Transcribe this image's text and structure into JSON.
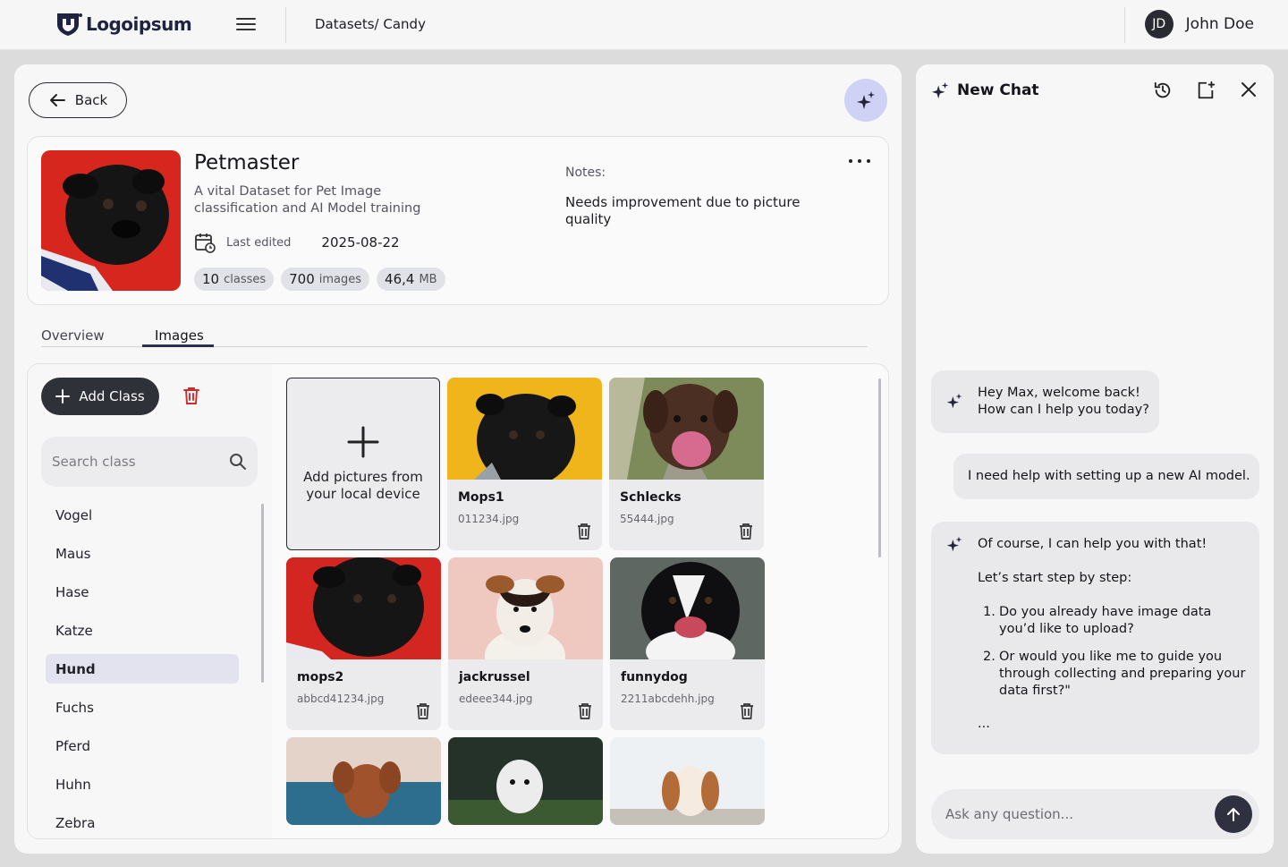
{
  "topbar": {
    "logo_text": "Logoipsum",
    "breadcrumb": "Datasets/ Candy",
    "user_initials": "JD",
    "user_name": "John Doe"
  },
  "main": {
    "back_label": "Back",
    "dataset": {
      "title": "Petmaster",
      "description": "A vital Dataset for Pet Image classification and AI Model training",
      "last_edited_label": "Last edited",
      "last_edited_value": "2025-08-22",
      "chips": [
        {
          "num": "10",
          "unit": "classes"
        },
        {
          "num": "700",
          "unit": "images"
        },
        {
          "num": "46,4",
          "unit": "MB"
        }
      ],
      "notes_label": "Notes:",
      "notes_text": "Needs improvement due to picture quality"
    },
    "tabs": [
      {
        "label": "Overview",
        "active": false
      },
      {
        "label": "Images",
        "active": true
      }
    ],
    "add_class_label": "Add Class",
    "search": {
      "placeholder": "Search class"
    },
    "classes": [
      "Vogel",
      "Maus",
      "Hase",
      "Katze",
      "Hund",
      "Fuchs",
      "Pferd",
      "Huhn",
      "Zebra"
    ],
    "active_class": "Hund",
    "add_tile_text": "Add pictures from your local device",
    "images": [
      {
        "name": "Mops1",
        "file": "011234.jpg"
      },
      {
        "name": "Schlecks",
        "file": "55444.jpg"
      },
      {
        "name": "mops2",
        "file": "abbcd41234.jpg"
      },
      {
        "name": "jackrussel",
        "file": "edeee344.jpg"
      },
      {
        "name": "funnydog",
        "file": "2211abcdehh.jpg"
      }
    ]
  },
  "chat": {
    "title": "New Chat",
    "messages": [
      {
        "role": "ai",
        "lines": [
          "Hey Max, welcome back!",
          "How can I help you today?"
        ]
      },
      {
        "role": "user",
        "text": "I need help with setting up a new AI model."
      },
      {
        "role": "ai",
        "intro": "Of course, I can help you with that!",
        "step": "Let’s start step by step:",
        "items": [
          "Do you already have image data you’d like to upload?",
          "Or would you like me to guide you through collecting and preparing your data first?\""
        ],
        "ellipsis": "..."
      }
    ],
    "input_placeholder": "Ask any question..."
  },
  "colors": {
    "accent_dark": "#2f3138",
    "fab": "#cfd1f5",
    "delete_red": "#d22a2a"
  }
}
